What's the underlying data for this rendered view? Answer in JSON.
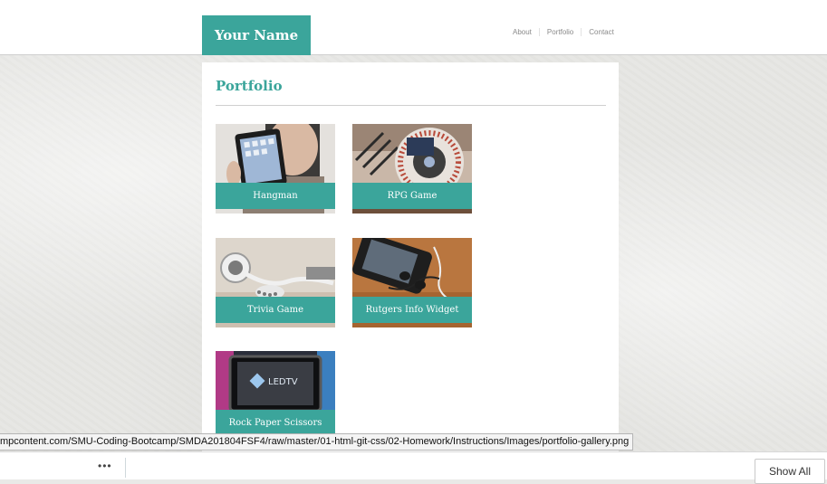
{
  "header": {
    "brand": "Your Name",
    "nav": [
      "About",
      "Portfolio",
      "Contact"
    ]
  },
  "main": {
    "title": "Portfolio",
    "projects": [
      {
        "label": "Hangman",
        "icon": "ipad-photo"
      },
      {
        "label": "RPG Game",
        "icon": "turntable-photo"
      },
      {
        "label": "Trivia Game",
        "icon": "earbuds-photo"
      },
      {
        "label": "Rutgers Info Widget",
        "icon": "phone-headphones-photo"
      },
      {
        "label": "Rock Paper Scissors",
        "icon": "led-tv-photo"
      }
    ],
    "tv_logo": "LEDTV"
  },
  "status_url": "mpcontent.com/SMU-Coding-Bootcamp/SMDA201804FSF4/raw/master/01-html-git-css/02-Homework/Instructions/Images/portfolio-gallery.png",
  "download_bar": {
    "more": "•••",
    "show_all": "Show All"
  },
  "colors": {
    "accent": "#3ba59b",
    "background": "#e7e7e4"
  }
}
